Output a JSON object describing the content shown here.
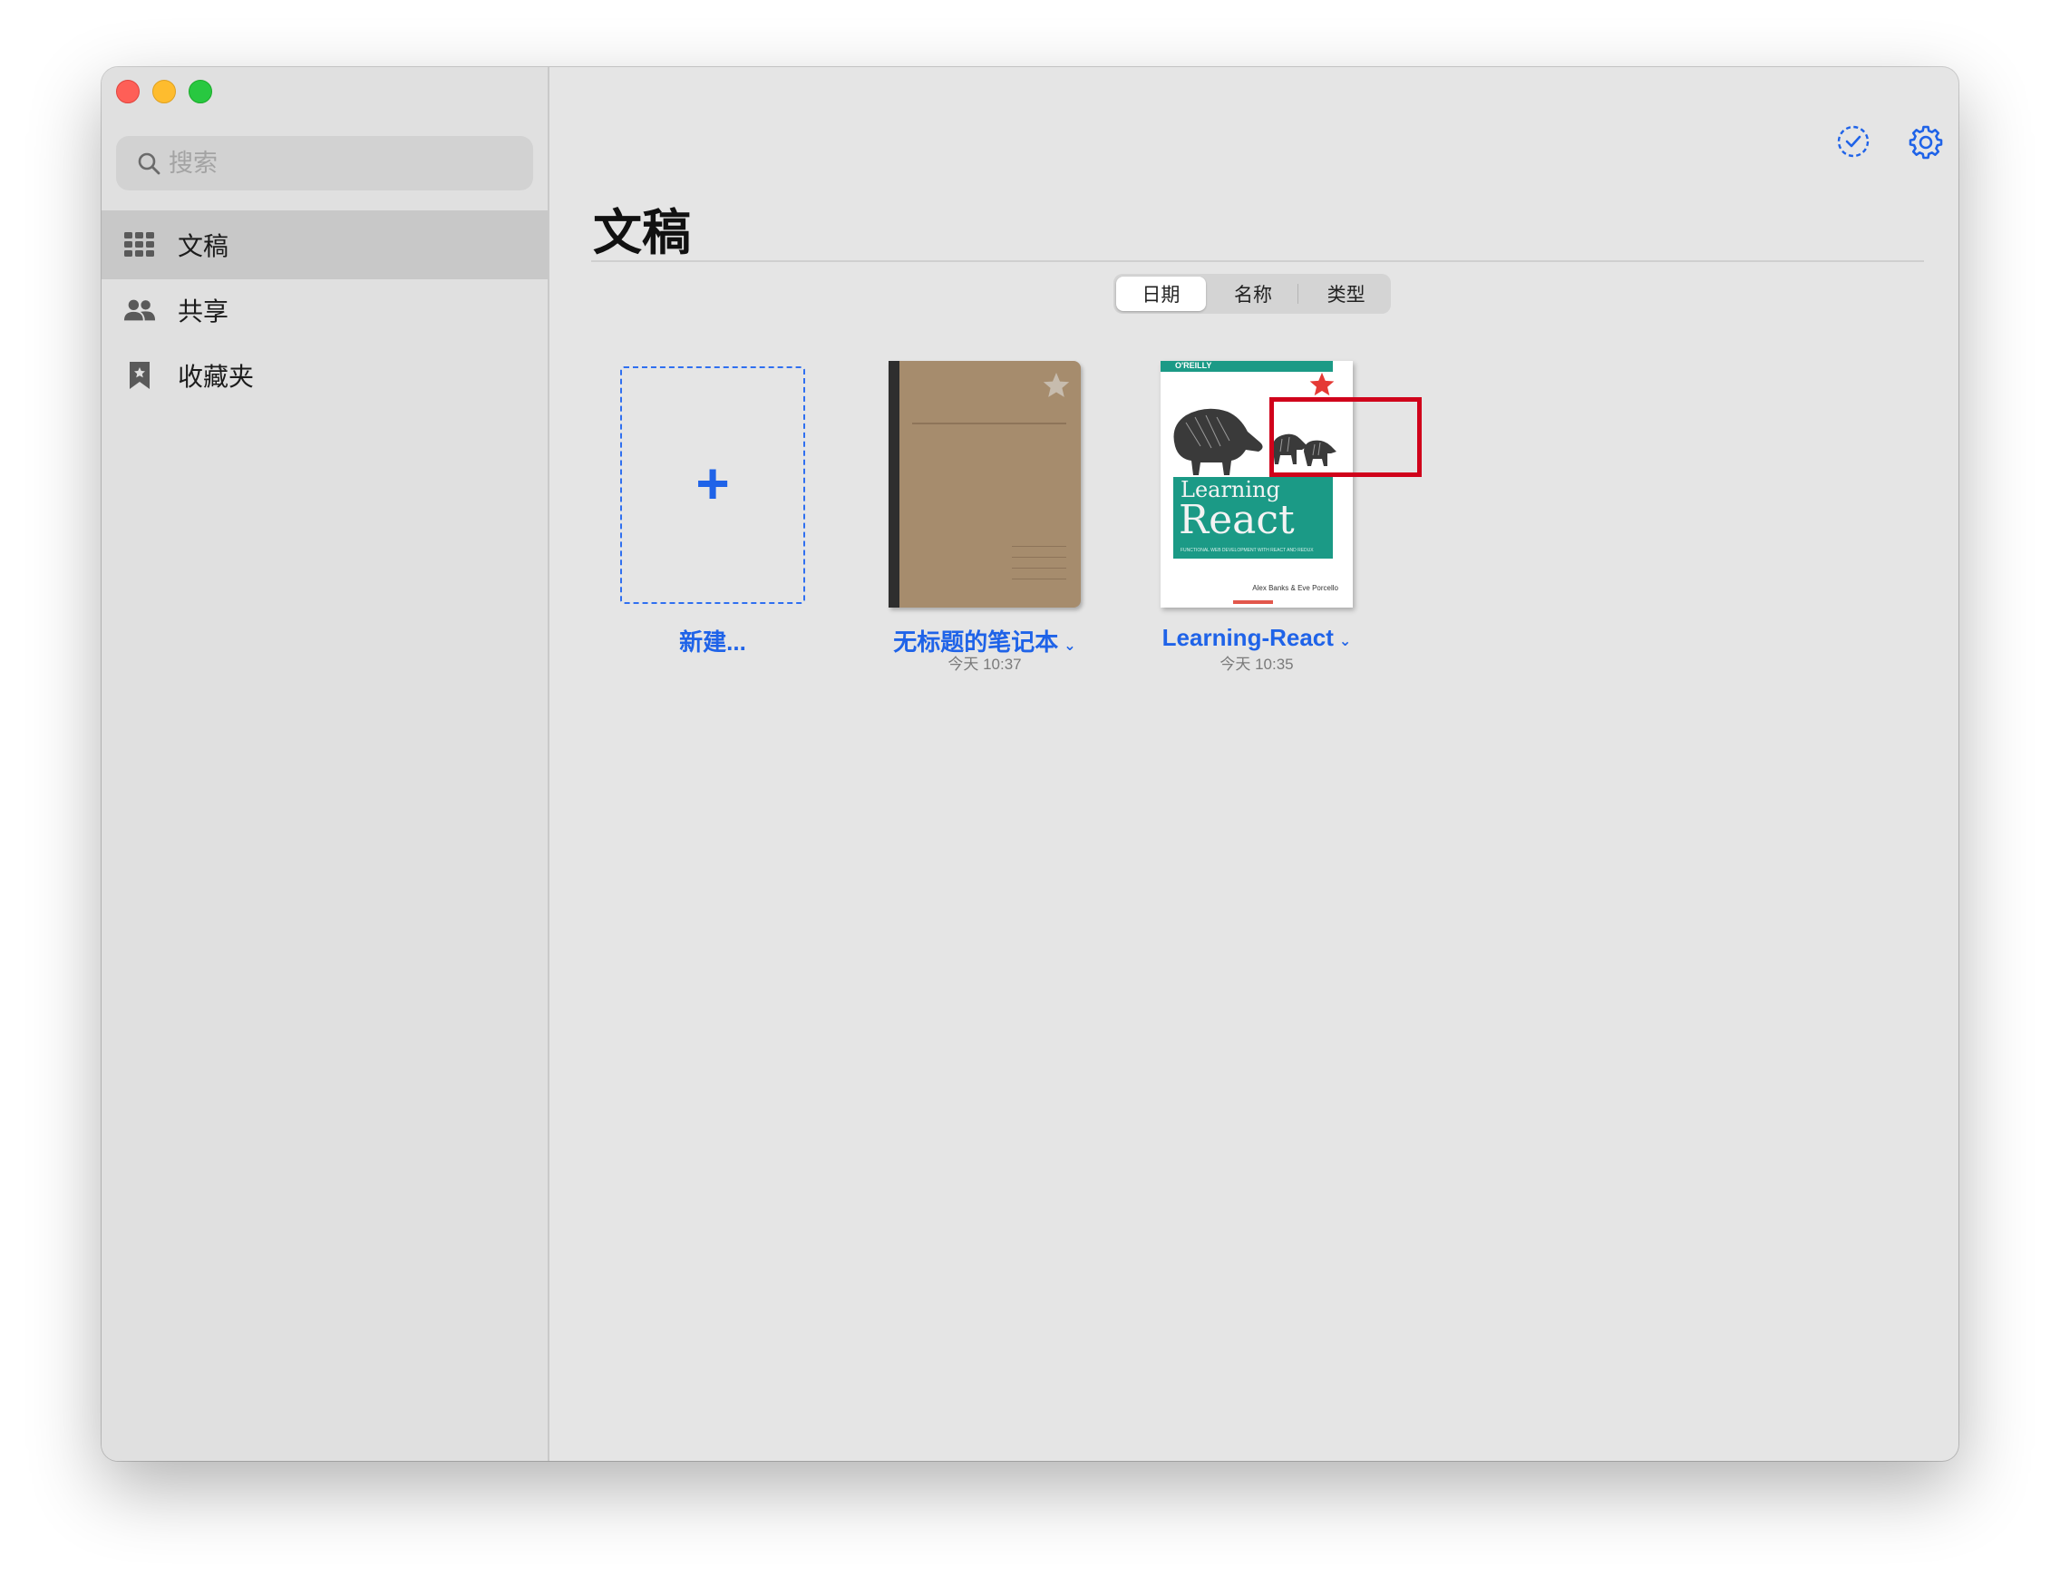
{
  "sidebar": {
    "search": {
      "placeholder": "搜索"
    },
    "items": [
      {
        "label": "文稿",
        "icon": "grid-icon",
        "selected": true
      },
      {
        "label": "共享",
        "icon": "people-icon",
        "selected": false
      },
      {
        "label": "收藏夹",
        "icon": "bookmark-icon",
        "selected": false
      }
    ]
  },
  "main": {
    "title": "文稿",
    "sort_tabs": [
      {
        "label": "日期",
        "active": true
      },
      {
        "label": "名称",
        "active": false
      },
      {
        "label": "类型",
        "active": false
      }
    ],
    "toolbar_icons": [
      "select-check-icon",
      "gear-icon",
      "list-view-icon"
    ],
    "documents": [
      {
        "label": "新建...",
        "type": "new"
      },
      {
        "label": "无标题的笔记本",
        "date": "今天 10:37",
        "favorited": false,
        "type": "notebook"
      },
      {
        "label": "Learning-React",
        "date": "今天 10:35",
        "favorited": true,
        "type": "book",
        "cover": {
          "publisher": "O'REILLY",
          "title_line1": "Learning",
          "title_line2": "React",
          "subtitle": "FUNCTIONAL WEB DEVELOPMENT WITH REACT AND REDUX",
          "authors": "Alex Banks & Eve Porcello"
        }
      }
    ]
  },
  "colors": {
    "accent": "#1f63e8",
    "favorite_star": "#e53935",
    "highlight_box": "#d0021b",
    "cover_green": "#1b9a86",
    "notebook_brown": "#a68c6d"
  }
}
